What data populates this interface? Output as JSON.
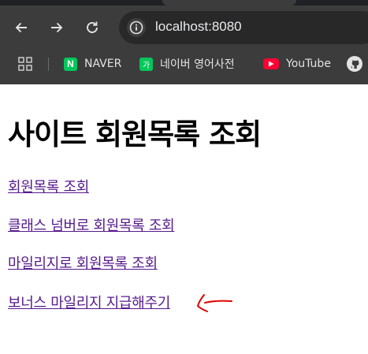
{
  "browser": {
    "url": "localhost:8080",
    "bookmarks": [
      {
        "label": "NAVER",
        "icon": "naver-icon"
      },
      {
        "label": "네이버 영어사전",
        "icon": "naver-dictionary-icon"
      },
      {
        "label": "YouTube",
        "icon": "youtube-icon"
      }
    ],
    "favicon_text": {
      "naver": "N",
      "dict": "가"
    }
  },
  "page": {
    "title": "사이트 회원목록 조회",
    "links": [
      "회원목록 조회",
      "클래스 넘버로 회원목록 조회",
      "마일리지로 회원목록 조회",
      "보너스 마일리지 지급해주기"
    ]
  },
  "colors": {
    "link": "#551a8b",
    "annotation": "#e00000",
    "toolbar": "#3c3c3c"
  }
}
